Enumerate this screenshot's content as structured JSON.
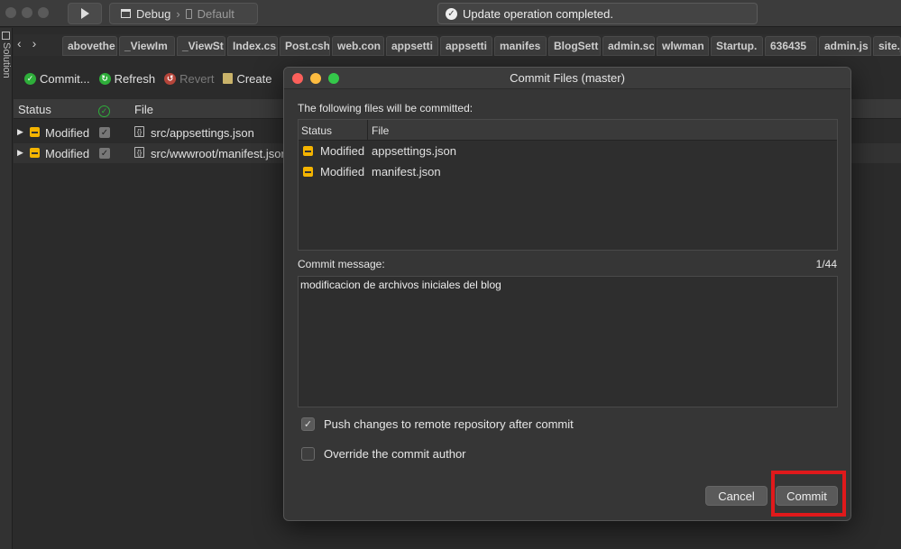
{
  "toolbar": {
    "config_name": "Debug",
    "config_separator": "›",
    "device": "Default",
    "status_message": "Update operation completed."
  },
  "sidebar": {
    "label": "Solution"
  },
  "tabs": [
    "abovethe",
    "_ViewIm",
    "_ViewSt",
    "Index.cs",
    "Post.csh",
    "web.con",
    "appsetti",
    "appsetti",
    "manifes",
    "BlogSett",
    "admin.sc",
    "wlwman",
    "Startup.",
    "636435",
    "admin.js",
    "site.js"
  ],
  "pad_toolbar": {
    "commit": "Commit...",
    "refresh": "Refresh",
    "revert": "Revert",
    "create": "Create"
  },
  "table": {
    "headers": {
      "status": "Status",
      "file": "File"
    },
    "rows": [
      {
        "status": "Modified",
        "file": "src/appsettings.json"
      },
      {
        "status": "Modified",
        "file": "src/wwwroot/manifest.json"
      }
    ]
  },
  "dialog": {
    "title": "Commit Files (master)",
    "files_label": "The following files will be committed:",
    "headers": {
      "status": "Status",
      "file": "File"
    },
    "files": [
      {
        "status": "Modified",
        "file": "appsettings.json"
      },
      {
        "status": "Modified",
        "file": "manifest.json"
      }
    ],
    "message_label": "Commit message:",
    "message_count": "1/44",
    "message": "modificacion de archivos iniciales del blog",
    "push_option": "Push changes to remote repository after commit",
    "push_checked": true,
    "override_option": "Override the commit author",
    "override_checked": false,
    "cancel": "Cancel",
    "commit": "Commit"
  },
  "colors": {
    "modified": "#f4b400",
    "highlight": "#e0191b",
    "close": "#fc605b",
    "minimize": "#fdbc40",
    "maximize": "#34c84a"
  }
}
